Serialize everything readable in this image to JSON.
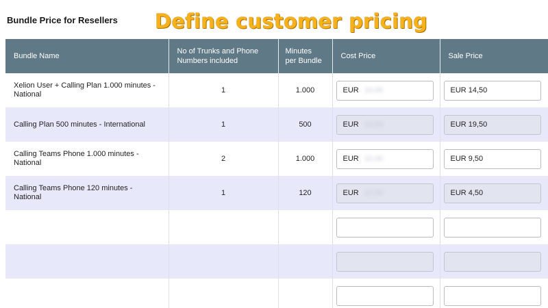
{
  "page": {
    "heading": "Bundle Price for Resellers",
    "overlay_title": "Define customer pricing"
  },
  "table": {
    "headers": {
      "bundle_name": "Bundle Name",
      "trunks": "No of Trunks and Phone Numbers included",
      "minutes": "Minutes per Bundle",
      "cost_price": "Cost Price",
      "sale_price": "Sale Price"
    },
    "currency": "EUR",
    "rows": [
      {
        "name": "Xelion User + Calling Plan 1.000 minutes - National",
        "trunks": "1",
        "minutes": "1.000",
        "cost": "10,00",
        "sale": "14,50"
      },
      {
        "name": "Calling Plan 500 minutes - International",
        "trunks": "1",
        "minutes": "500",
        "cost": "10,00",
        "sale": "19,50"
      },
      {
        "name": "Calling Teams Phone 1.000 minutes - National",
        "trunks": "2",
        "minutes": "1.000",
        "cost": "10,00",
        "sale": "9,50"
      },
      {
        "name": "Calling Teams Phone 120 minutes - National",
        "trunks": "1",
        "minutes": "120",
        "cost": "10,00",
        "sale": "4,50"
      }
    ]
  }
}
